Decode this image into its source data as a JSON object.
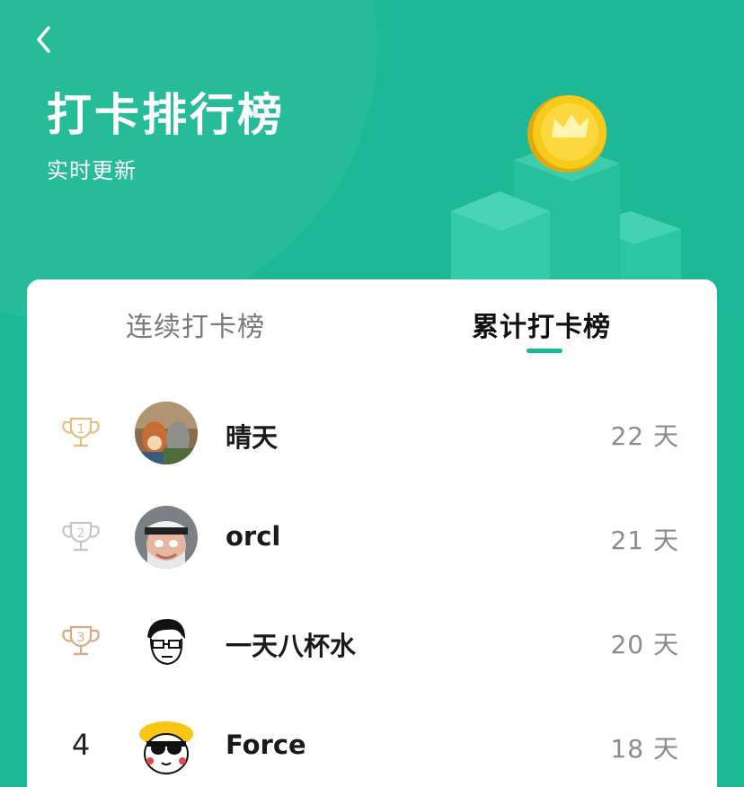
{
  "header": {
    "title": "打卡排行榜",
    "subtitle": "实时更新",
    "bg_color": "#1db996"
  },
  "tabs": [
    {
      "label": "连续打卡榜",
      "active": false
    },
    {
      "label": "累计打卡榜",
      "active": true
    }
  ],
  "ranking": [
    {
      "rank": "1",
      "name": "晴天",
      "days": "22 天",
      "trophy_color": "#e2c07f"
    },
    {
      "rank": "2",
      "name": "orcl",
      "days": "21 天",
      "trophy_color": "#c3c8cc"
    },
    {
      "rank": "3",
      "name": "一天八杯水",
      "days": "20 天",
      "trophy_color": "#d8ab83"
    },
    {
      "rank": "4",
      "name": "Force",
      "days": "18 天"
    }
  ],
  "colors": {
    "accent": "#1bb894",
    "coin": "#f7cb1c"
  }
}
